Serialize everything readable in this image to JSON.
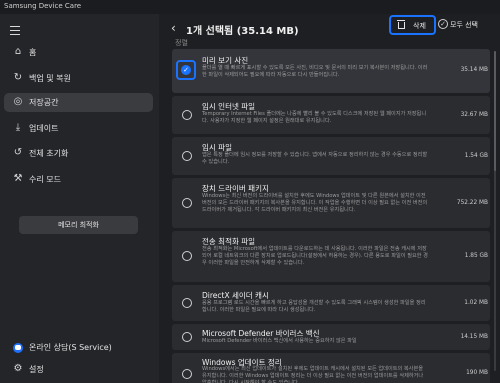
{
  "window": {
    "title": "Samsung Device Care"
  },
  "sidebar": {
    "items": [
      {
        "icon": "home-icon",
        "label": "홈"
      },
      {
        "icon": "backup-icon",
        "label": "백업 및 복원"
      },
      {
        "icon": "storage-icon",
        "label": "저장공간",
        "active": true
      },
      {
        "icon": "download-icon",
        "label": "업데이트"
      },
      {
        "icon": "reset-icon",
        "label": "전체 초기화"
      },
      {
        "icon": "wrench-icon",
        "label": "수리 모드"
      }
    ],
    "memory_button": "메모리 최적화",
    "support_label": "온라인 상담(S Service)",
    "settings_label": "설정"
  },
  "header": {
    "title": "1개 선택됨 (35.14 MB)",
    "delete_label": "삭제",
    "select_all_label": "모두 선택",
    "sort_label": "정렬"
  },
  "items": [
    {
      "title": "미리 보기 사진",
      "desc": "폴더를 열 때 빠르게 표시할 수 있도록 모든 사진, 비디오 및 문서의 미리 보기 복사본이 저장됩니다. 이러한 파일이 삭제되어도 필요에 따라 자동으로 다시 만들어집니다.",
      "size": "35.14 MB",
      "checked": true
    },
    {
      "title": "임시 인터넷 파일",
      "desc": "Temporary Internet Files 폴더에는 나중에 빨리 볼 수 있도록 디스크에 저장된 웹 페이지가 저장됩니다. 사용자가 지정한 웹 페이지 설정은 원래대로 유지됩니다.",
      "size": "32.67 MB",
      "checked": false
    },
    {
      "title": "임시 파일",
      "desc": "앱은 특정 폴더에 임시 정보를 저장할 수 있습니다. 앱에서 자동으로 정리하지 않는 경우 수동으로 정리할 수 있습니다.",
      "size": "1.54 GB",
      "checked": false
    },
    {
      "title": "장치 드라이버 패키지",
      "desc": "Windows는 최신 버전의 드라이버를 설치한 후에도 Windows 업데이트 및 다른 원본에서 설치한 이전 버전의 모든 드라이버 패키지의 복사본을 유지합니다. 이 작업을 수행하면 더 이상 필요 없는 이전 버전의 드라이버가 제거됩니다. 각 드라이버 패키지의 최신 버전은 유지됩니다.",
      "size": "752.22 MB",
      "checked": false
    },
    {
      "title": "전송 최적화 파일",
      "desc": "전송 최적화는 Microsoft에서 업데이트를 다운로드하는 데 사용됩니다. 이러한 파일은 전송 캐시에 저장되어 로컬 네트워크의 다른 장치로 업로드됩니다(설정에서 허용하는 경우). 다른 용도로 파일이 필요한 경우 이러한 파일을 안전하게 삭제할 수 있습니다.",
      "size": "1.85 GB",
      "checked": false
    },
    {
      "title": "DirectX 세이더 캐시",
      "desc": "응용 프로그램 로드 시간을 빠르게 하고 응답성을 개선할 수 있도록 그래픽 시스템이 생성한 파일을 정리합니다. 이러한 파일은 필요에 따라 다시 생성됩니다.",
      "size": "1.02 MB",
      "checked": false
    },
    {
      "title": "Microsoft Defender 바이러스 백신",
      "desc": "Microsoft Defender 바이러스 백신에서 사용하는 중요하지 않은 파일",
      "size": "14.15 MB",
      "checked": false
    },
    {
      "title": "Windows 업데이트 정리",
      "desc": "Windows에서는 최신 업데이트가 설치된 후에도 업데이트 캐시에서 설치된 모든 업데이트의 복사본을 유지합니다. 이러한 Windows 업데이트 정리는 더 이상 필요 없는 이전 버전의 업데이트를 삭제하거나 압축합니다. 다시 시작해야 할 수도 있습니다.",
      "size": "190 MB",
      "checked": false
    }
  ]
}
